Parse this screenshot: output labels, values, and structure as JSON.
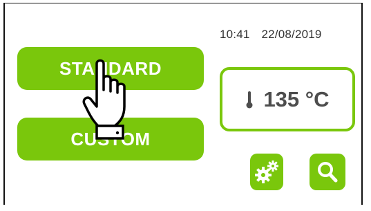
{
  "status": {
    "time": "10:41",
    "date": "22/08/2019"
  },
  "buttons": {
    "standard_label": "STANDARD",
    "custom_label": "CUSTOM"
  },
  "temperature": {
    "display": "135 °C",
    "icon": "thermometer-icon"
  },
  "actions": [
    {
      "icon": "gears-icon"
    },
    {
      "icon": "search-icon"
    }
  ],
  "overlay": {
    "icon": "pointing-hand-icon"
  },
  "colors": {
    "accent_green": "#7ac70c",
    "text_grey": "#4d4d4d",
    "background": "#ffffff"
  }
}
